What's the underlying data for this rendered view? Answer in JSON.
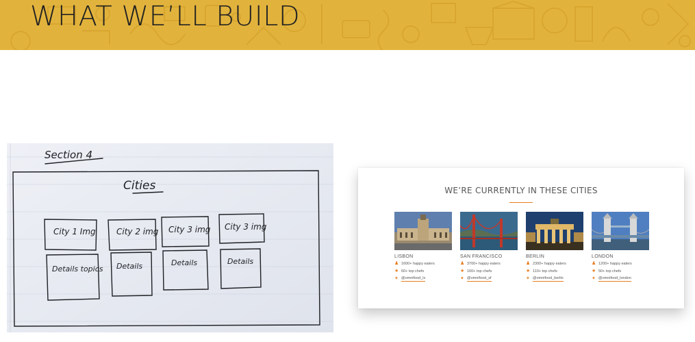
{
  "slide": {
    "title": "WHAT WE’LL BUILD"
  },
  "sketch": {
    "section_label": "Section 4",
    "heading": "Cities",
    "boxes_top": [
      "City 1 Img",
      "City 2 img",
      "City 3 img",
      "City 3 img"
    ],
    "boxes_bottom": [
      "Details topics",
      "Details",
      "Details",
      "Details"
    ]
  },
  "card": {
    "title": "WE’RE CURRENTLY IN THESE CITIES",
    "accent_color": "#e67e22",
    "cities": [
      {
        "name": "LISBON",
        "eaters": "1600+ happy eaters",
        "chefs": "60+ top chefs",
        "twitter": "@omnifood_lx",
        "photo": "lisbon-photo"
      },
      {
        "name": "SAN FRANCISCO",
        "eaters": "3700+ happy eaters",
        "chefs": "160+ top chefs",
        "twitter": "@omnifood_sf",
        "photo": "san-francisco-photo"
      },
      {
        "name": "BERLIN",
        "eaters": "2300+ happy eaters",
        "chefs": "110+ top chefs",
        "twitter": "@omnifood_berlin",
        "photo": "berlin-photo"
      },
      {
        "name": "LONDON",
        "eaters": "1200+ happy eaters",
        "chefs": "50+ top chefs",
        "twitter": "@omnifood_london",
        "photo": "london-photo"
      }
    ]
  },
  "icons": {
    "eaters": "person-icon",
    "chefs": "star-icon",
    "twitter": "twitter-icon"
  }
}
